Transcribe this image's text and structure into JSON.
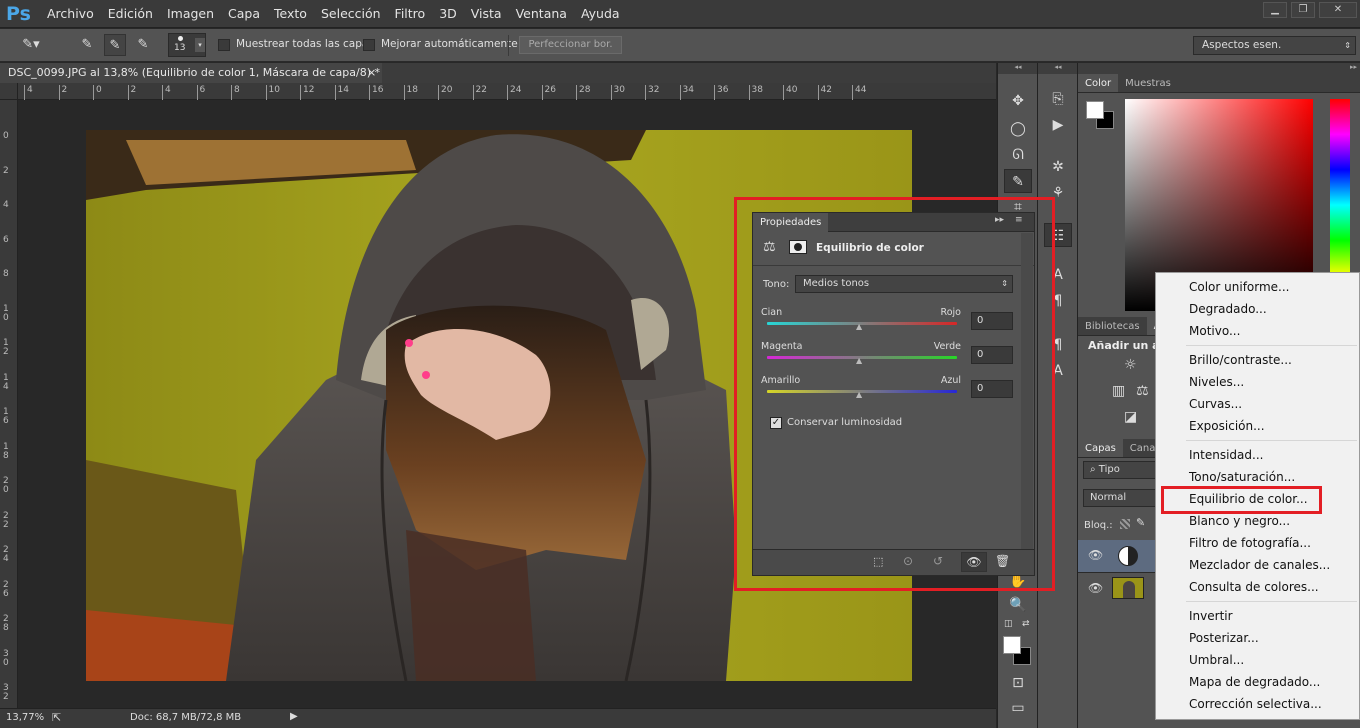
{
  "app": {
    "logo": "Ps"
  },
  "menu": [
    "Archivo",
    "Edición",
    "Imagen",
    "Capa",
    "Texto",
    "Selección",
    "Filtro",
    "3D",
    "Vista",
    "Ventana",
    "Ayuda"
  ],
  "window_controls": {
    "minimize": "▁",
    "restore": "❐",
    "close": "✕"
  },
  "options_bar": {
    "brush_size": "13",
    "sample_all_layers": "Muestrear todas las capas",
    "auto_enhance": "Mejorar automáticamente",
    "refine_edge": "Perfeccionar bor.",
    "workspace": "Aspectos esen."
  },
  "document": {
    "tab_title": "DSC_0099.JPG al 13,8% (Equilibrio de color 1, Máscara de capa/8) *",
    "tab_close": "×",
    "h_ruler_ticks": [
      "4",
      "2",
      "0",
      "2",
      "4",
      "6",
      "8",
      "10",
      "12",
      "14",
      "16",
      "18",
      "20",
      "22",
      "24",
      "26",
      "28",
      "30",
      "32",
      "34",
      "36",
      "38",
      "40",
      "42",
      "44"
    ],
    "v_ruler_ticks": [
      "0",
      "2",
      "4",
      "6",
      "8",
      "1 0",
      "1 2",
      "1 4",
      "1 6",
      "1 8",
      "2 0",
      "2 2",
      "2 4",
      "2 6",
      "2 8",
      "3 0",
      "3 2"
    ]
  },
  "status": {
    "zoom": "13,77%",
    "doc_size": "Doc: 68,7 MB/72,8 MB"
  },
  "properties": {
    "tab": "Propiedades",
    "title": "Equilibrio de color",
    "tone_label": "Tono:",
    "tone_value": "Medios tonos",
    "sliders": [
      {
        "left": "Cian",
        "right": "Rojo",
        "value": "0",
        "gradient": "linear-gradient(90deg,#27d6d6,#d62727)"
      },
      {
        "left": "Magenta",
        "right": "Verde",
        "value": "0",
        "gradient": "linear-gradient(90deg,#d627d6,#27d627)"
      },
      {
        "left": "Amarillo",
        "right": "Azul",
        "value": "0",
        "gradient": "linear-gradient(90deg,#d6d627,#2727d6)"
      }
    ],
    "preserve_luminosity": "Conservar luminosidad"
  },
  "right_panels": {
    "color_tabs": [
      "Color",
      "Muestras"
    ],
    "libraries_tabs": [
      "Bibliotecas",
      "A"
    ],
    "adjustments_label": "Añadir un aju",
    "layers_tabs": [
      "Capas",
      "Canale"
    ],
    "filter_kind": "Tipo",
    "blend_mode": "Normal",
    "lock_label": "Bloq.:"
  },
  "context_menu": {
    "groups": [
      [
        "Color uniforme...",
        "Degradado...",
        "Motivo..."
      ],
      [
        "Brillo/contraste...",
        "Niveles...",
        "Curvas...",
        "Exposición..."
      ],
      [
        "Intensidad...",
        "Tono/saturación...",
        "Equilibrio de color...",
        "Blanco y negro...",
        "Filtro de fotografía...",
        "Mezclador de canales...",
        "Consulta de colores..."
      ],
      [
        "Invertir",
        "Posterizar...",
        "Umbral...",
        "Mapa de degradado...",
        "Corrección selectiva..."
      ]
    ],
    "highlighted": "Equilibrio de color..."
  },
  "colors": {
    "highlight_red": "#e31e24",
    "ui_dark": "#535353",
    "ps_blue": "#4ba7e8"
  }
}
